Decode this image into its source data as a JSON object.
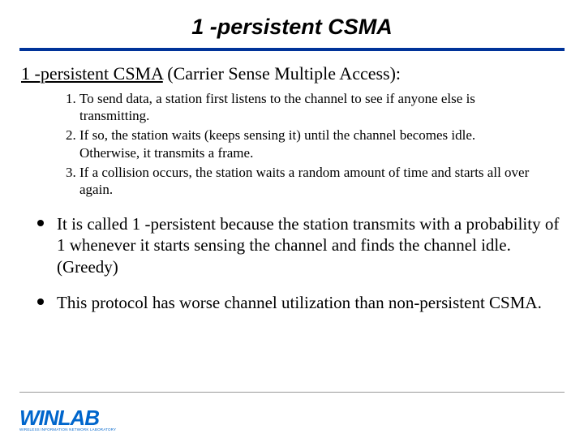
{
  "title": "1 -persistent CSMA",
  "lead": {
    "underlined": "1 -persistent CSMA",
    "rest": " (Carrier Sense Multiple Access):"
  },
  "steps": [
    "To send data, a station first listens to the channel to see if anyone else is transmitting.",
    "If so, the station waits (keeps sensing it) until the channel becomes idle. Otherwise, it transmits a frame.",
    "If a collision occurs, the station waits a random amount of time and starts all over again."
  ],
  "bullets": [
    "It is called 1 -persistent because the station transmits with a probability of 1 whenever it starts sensing the channel and finds the channel idle. (Greedy)",
    "This protocol has worse channel utilization than non-persistent CSMA."
  ],
  "logo": {
    "text": "WINLAB",
    "sub": "WIRELESS INFORMATION NETWORK LABORATORY"
  }
}
